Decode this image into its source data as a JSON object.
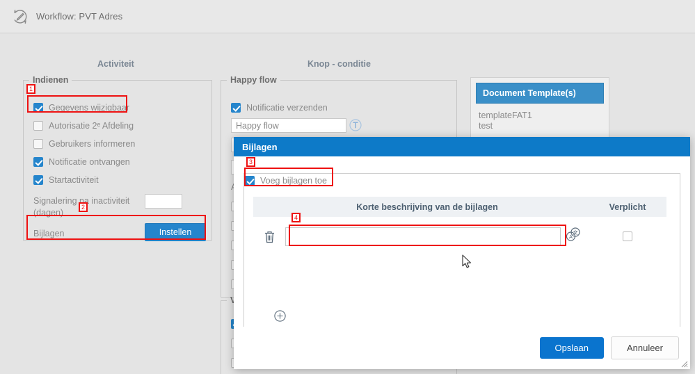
{
  "header": {
    "icon": "workflow-edit-icon",
    "title": "Workflow: PVT Adres"
  },
  "columns": {
    "activity": "Activiteit",
    "button_condition": "Knop - conditie"
  },
  "panels": {
    "indienen": {
      "legend": "Indienen",
      "checkboxes": [
        {
          "label": "Gegevens wijzigbaar",
          "checked": true
        },
        {
          "label": "Autorisatie 2ᵉ Afdeling",
          "checked": false
        },
        {
          "label": "Gebruikers informeren",
          "checked": false
        },
        {
          "label": "Notificatie ontvangen",
          "checked": true
        },
        {
          "label": "Startactiviteit",
          "checked": true
        }
      ],
      "signalering_label": "Signalering na inactiviteit (dagen)",
      "signalering_value": "",
      "bijlagen_label": "Bijlagen",
      "instellen_button": "Instellen"
    },
    "happyflow": {
      "legend": "Happy flow",
      "checkbox_label": "Notificatie verzenden",
      "checkbox_checked": true,
      "name_value": "Happy flow",
      "translate_icon": "translate-text-icon",
      "afwijzen_partial": "A"
    },
    "vervolg": {
      "legend_partial": "V"
    }
  },
  "document_templates": {
    "title": "Document Template(s)",
    "items": [
      "templateFAT1",
      "test"
    ]
  },
  "modal": {
    "title": "Bijlagen",
    "add_attachments_label": "Voeg bijlagen toe",
    "add_attachments_checked": true,
    "table": {
      "headers": {
        "description": "Korte beschrijving van de bijlagen",
        "required": "Verplicht"
      },
      "rows": [
        {
          "delete_icon": "trash-icon",
          "description_value": "",
          "translate_icon": "translate-icon",
          "required_checked": false
        }
      ],
      "add_row_icon": "plus-circle-icon"
    },
    "buttons": {
      "save": "Opslaan",
      "cancel": "Annuleer"
    }
  },
  "annotations": [
    {
      "number": "1"
    },
    {
      "number": "2"
    },
    {
      "number": "3"
    },
    {
      "number": "4"
    }
  ],
  "colors": {
    "accent_blue": "#0d7ac8",
    "checkbox_blue": "#2585cc",
    "annotation_red": "#ee1111",
    "page_bg": "#e4e4e4"
  }
}
